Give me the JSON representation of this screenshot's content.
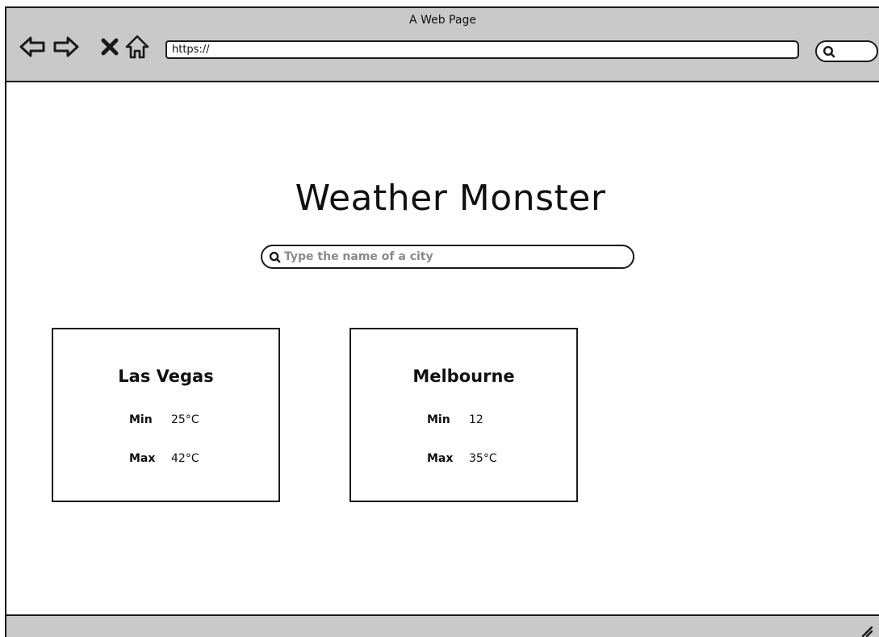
{
  "window": {
    "title": "A Web Page"
  },
  "toolbar": {
    "url_value": "https://",
    "icons": {
      "back": "back-arrow-icon",
      "forward": "forward-arrow-icon",
      "stop": "close-icon",
      "home": "home-icon",
      "search": "search-icon"
    }
  },
  "main": {
    "title": "Weather Monster",
    "search": {
      "placeholder": "Type the name of a city"
    },
    "cards": [
      {
        "city": "Las Vegas",
        "min_label": "Min",
        "min_value": "25°C",
        "max_label": "Max",
        "max_value": "42°C"
      },
      {
        "city": "Melbourne",
        "min_label": "Min",
        "min_value": "12",
        "max_label": "Max",
        "max_value": "35°C"
      }
    ]
  },
  "colors": {
    "chrome": "#c9c9c9",
    "border": "#1a1a1a",
    "placeholder": "#8a8a8a",
    "background": "#ffffff"
  }
}
